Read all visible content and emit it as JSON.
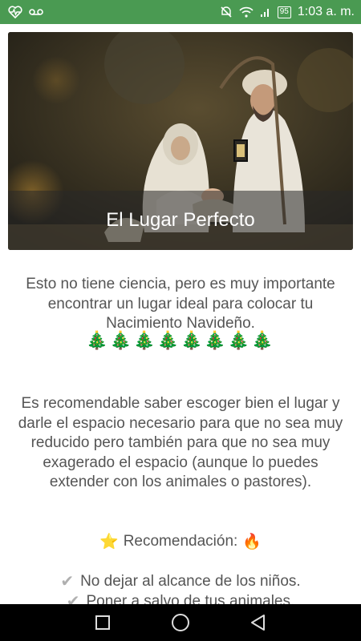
{
  "status_bar": {
    "time": "1:03 a. m.",
    "battery": "95",
    "icons": [
      "health-icon",
      "voicemail-icon",
      "mute-icon",
      "wifi-icon",
      "signal-icon",
      "battery-icon"
    ],
    "background": "#4a9a52"
  },
  "hero": {
    "caption": "El Lugar Perfecto",
    "image_description_icon": "nativity-image"
  },
  "body": {
    "paragraph1": "Esto no tiene ciencia, pero es muy importante encontrar un lugar ideal para colocar tu Nacimiento Navideño.",
    "trees": "🎄🎄🎄🎄🎄🎄🎄🎄",
    "paragraph2": "Es recomendable saber escoger bien el lugar y darle el espacio necesario para que no sea muy reducido pero también para que no sea muy exagerado el espacio (aunque lo puedes extender con los animales o pastores).",
    "recommendation_label": "Recomendación:",
    "recommendation_star": "⭐",
    "recommendation_fire": "🔥",
    "checklist": [
      {
        "icon": "✔",
        "text": "No dejar al alcance de los niños."
      },
      {
        "icon": "✔",
        "text": "Poner a salvo de tus animales."
      }
    ]
  },
  "nav_bar": {
    "icons": [
      "square-recents-icon",
      "circle-home-icon",
      "triangle-back-icon"
    ]
  }
}
